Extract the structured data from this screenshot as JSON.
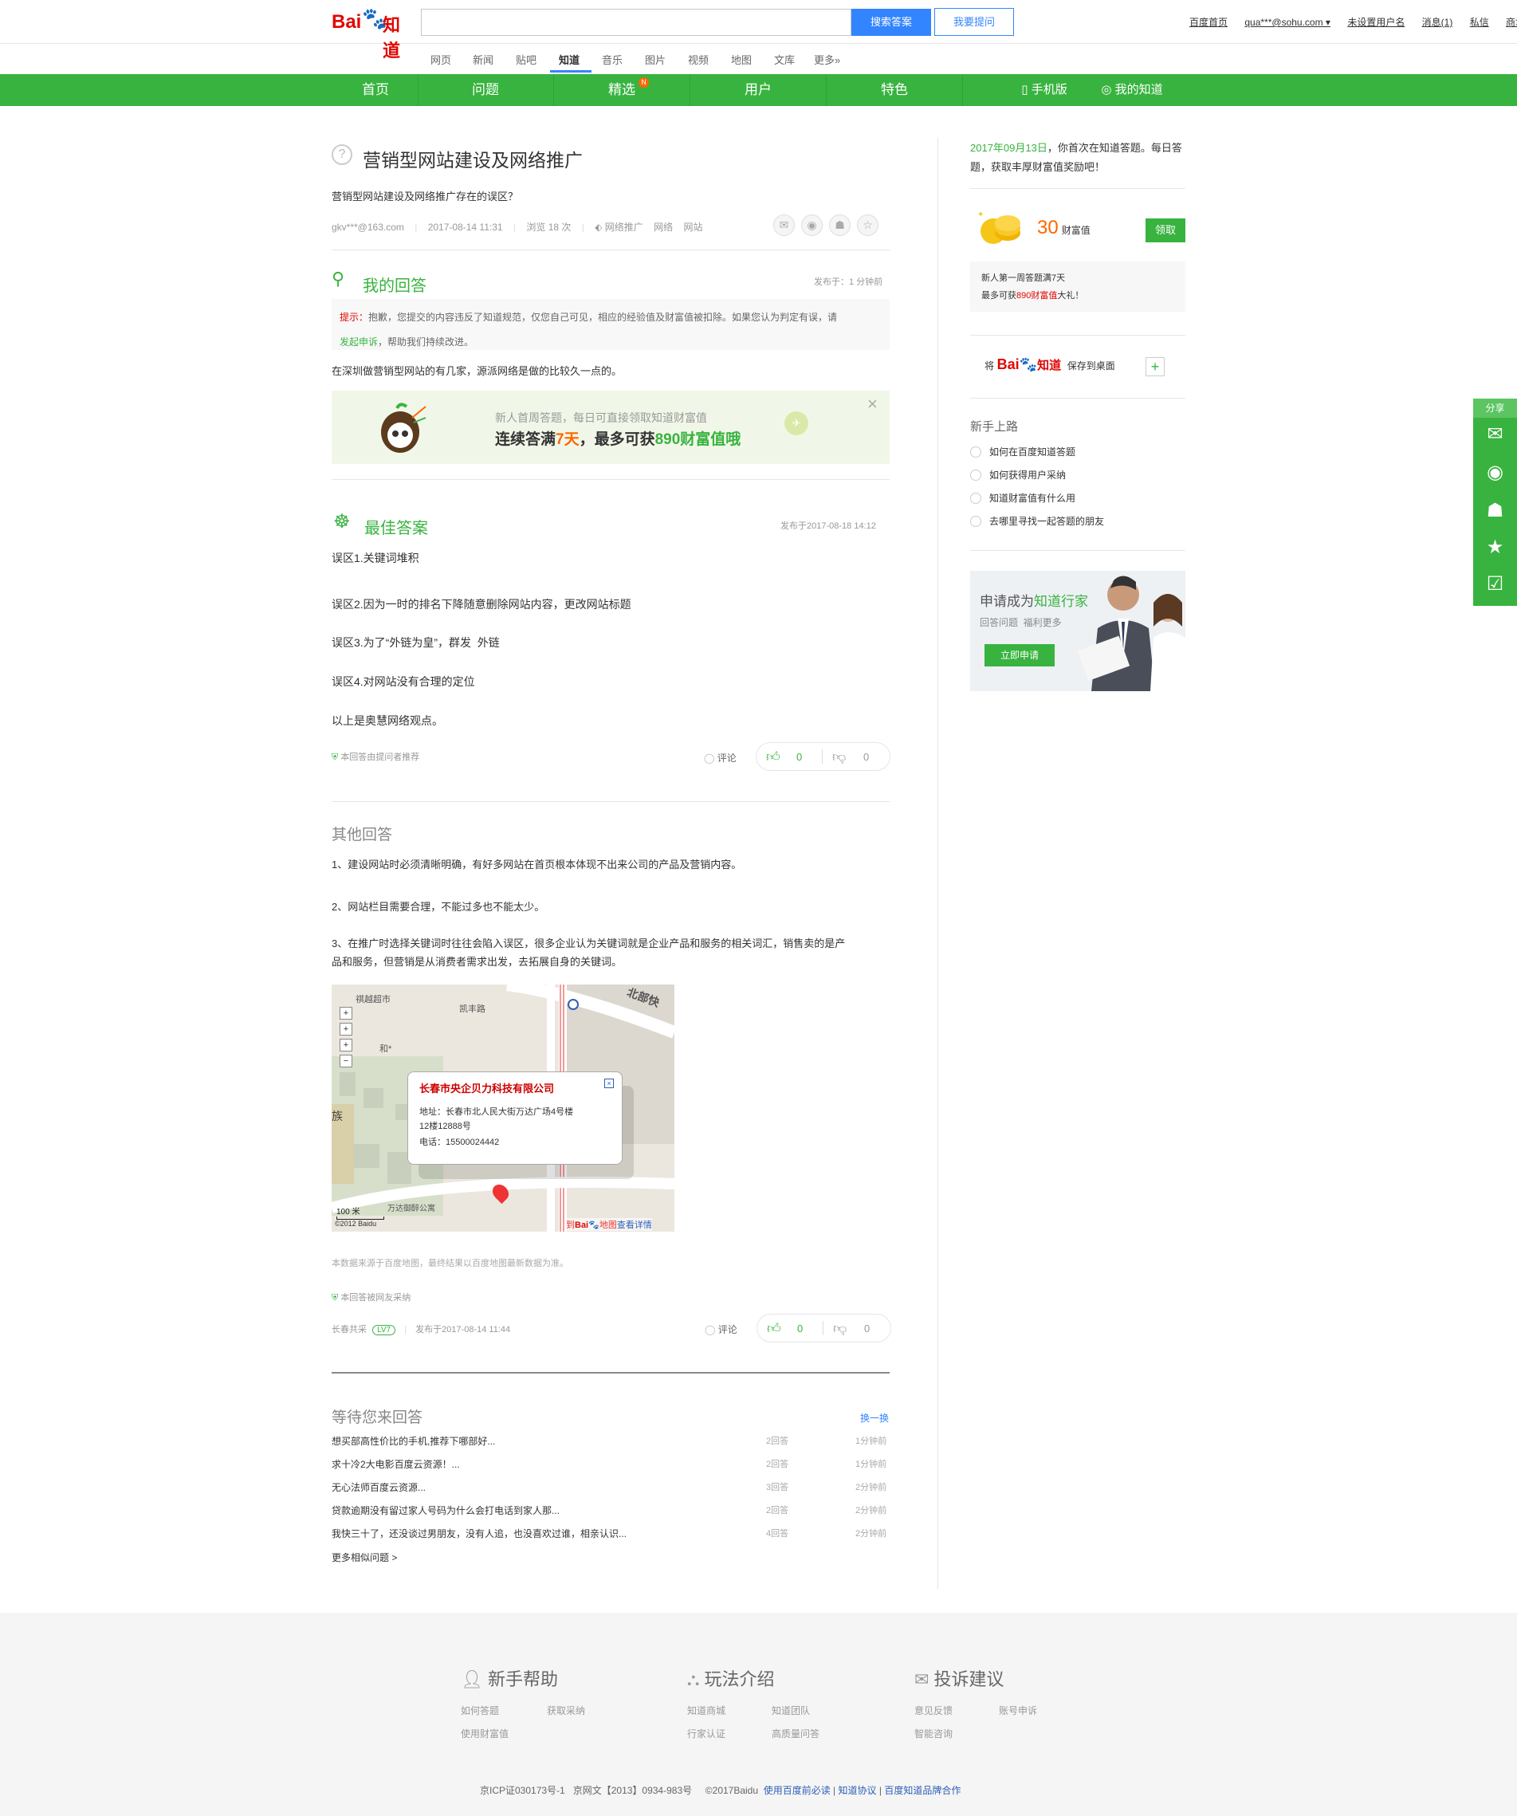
{
  "header": {
    "logo_text": "Bai",
    "logo_paw": "🐾",
    "logo_zhidao": "知道",
    "search_placeholder": "",
    "search_button": "搜索答案",
    "ask_button": "我要提问",
    "links": [
      "百度首页",
      "qua***@sohu.com ▾",
      "未设置用户名",
      "消息(1)",
      "私信",
      "商城"
    ]
  },
  "subnav": [
    "网页",
    "新闻",
    "贴吧",
    "知道",
    "音乐",
    "图片",
    "视频",
    "地图",
    "文库",
    "更多»"
  ],
  "greennav": {
    "items": [
      "首页",
      "问题",
      "精选",
      "用户",
      "特色"
    ],
    "badge": "N",
    "mobile": "手机版",
    "mine": "我的知道"
  },
  "question": {
    "title": "营销型网站建设及网络推广",
    "desc": "营销型网站建设及网络推广存在的误区？",
    "asker": "gkv***@163.com",
    "time": "2017-08-14 11:31",
    "views": "浏览 18 次",
    "tags": [
      "网络推广",
      "网络",
      "网站"
    ]
  },
  "my_answer": {
    "heading": "我的回答",
    "posted": "发布于：1 分钟前",
    "tip_label": "提示：",
    "tip_text": "抱歉，您提交的内容违反了知道规范，仅您自己可见，相应的经验值及财富值被扣除。如果您认为判定有误，请",
    "tip_link": "发起申诉",
    "tip_end": "，帮助我们持续改进。",
    "content": "在深圳做营销型网站的有几家，源派网络是做的比较久一点的。"
  },
  "banner": {
    "line1": "新人首周答题，每日可直接领取知道财富值",
    "line2a": "连续答满",
    "line2b": "7天",
    "line2c": "，最多可获",
    "line2d": "890财富值哦"
  },
  "best": {
    "heading": "最佳答案",
    "posted": "发布于2017-08-18 14:12",
    "lines": [
      "误区1.关键词堆积",
      "误区2.因为一时的排名下降随意删除网站内容，更改网站标题",
      "误区3.为了“外链为皇”，群发  外链",
      "误区4.对网站没有合理的定位",
      "以上是奥慧网络观点。"
    ],
    "recommend": "本回答由提问者推荐",
    "comment": "评论",
    "up": "0",
    "down": "0"
  },
  "other": {
    "heading": "其他回答",
    "lines": [
      "1、建设网站时必须清晰明确，有好多网站在首页根本体现不出来公司的产品及营销内容。",
      "2、网站栏目需要合理，不能过多也不能太少。",
      "3、在推广时选择关键词时往往会陷入误区，很多企业认为关键词就是企业产品和服务的相关词汇，销售卖的是产",
      "品和服务，但营销是从消费者需求出发，去拓展自身的关键词。"
    ],
    "map_company": "长春市央企贝力科技有限公司",
    "map_addr1": "地址：长春市北人民大街万达广场4号楼",
    "map_addr2": "12楼12888号",
    "map_phone": "电话：15500024442",
    "map_scale": "100 米",
    "map_copy": "©2012 Baidu",
    "map_link": "到",
    "map_link2": "地图",
    "map_link3": "查看详情",
    "map_labels": [
      "祺越超市",
      "凯丰路",
      "北部快",
      "族",
      "和*",
      "万达御醉公寓"
    ],
    "source": "本数据来源于百度地图，最终结果以百度地图最新数据为准。",
    "adopted": "本回答被网友采纳",
    "user": "长春共采",
    "level": "LV7",
    "posted": "发布于2017-08-14 11:44",
    "comment": "评论",
    "up": "0",
    "down": "0"
  },
  "waiting": {
    "heading": "等待您来回答",
    "refresh": "换一换",
    "rows": [
      {
        "q": "想买部高性价比的手机,推荐下哪部好...",
        "a": "2回答",
        "t": "1分钟前"
      },
      {
        "q": "求十冷2大电影百度云资源！...",
        "a": "2回答",
        "t": "1分钟前"
      },
      {
        "q": "无心法师百度云资源...",
        "a": "3回答",
        "t": "2分钟前"
      },
      {
        "q": "贷款逾期没有留过家人号码为什么会打电话到家人那...",
        "a": "2回答",
        "t": "2分钟前"
      },
      {
        "q": "我快三十了，还没谈过男朋友，没有人追，也没喜欢过谁，相亲认识...",
        "a": "4回答",
        "t": "2分钟前"
      }
    ],
    "more": "更多相似问题 >"
  },
  "sidebar": {
    "greet_date": "2017年09月13日",
    "greet_text": "，你首次在知道答题。每日答题，获取丰厚财富值奖励吧！",
    "wealth_num": "30",
    "wealth_unit": "财富值",
    "claim": "领取",
    "newbie1": "新人第一周答题满7天",
    "newbie2a": "最多可获",
    "newbie2b": "890财富值",
    "newbie2c": "大礼！",
    "save_pre": "将",
    "save_post": "保存到桌面",
    "guide_title": "新手上路",
    "guide": [
      "如何在百度知道答题",
      "如何获得用户采纳",
      "知道财富值有什么用",
      "去哪里寻找一起答题的朋友"
    ],
    "apply_title_a": "申请成为",
    "apply_title_b": "知道行家",
    "apply_sub": "回答问题  福利更多",
    "apply_btn": "立即申请"
  },
  "share": {
    "label": "分享"
  },
  "footer": {
    "cols": [
      {
        "title": "新手帮助",
        "links": [
          "如何答题",
          "获取采纳",
          "使用财富值"
        ]
      },
      {
        "title": "玩法介绍",
        "links": [
          "知道商城",
          "知道团队",
          "行家认证",
          "高质量问答"
        ]
      },
      {
        "title": "投诉建议",
        "links": [
          "意见反馈",
          "账号申诉",
          "智能咨询"
        ]
      }
    ],
    "copyright": "京ICP证030173号-1   京网文【2013】0934-983号     ©2017Baidu",
    "links": [
      "使用百度前必读",
      "知道协议",
      "百度知道品牌合作"
    ]
  },
  "colors": {
    "green": "#38b33f",
    "blue": "#3385ff",
    "red": "#e10601",
    "orange": "#f60"
  }
}
